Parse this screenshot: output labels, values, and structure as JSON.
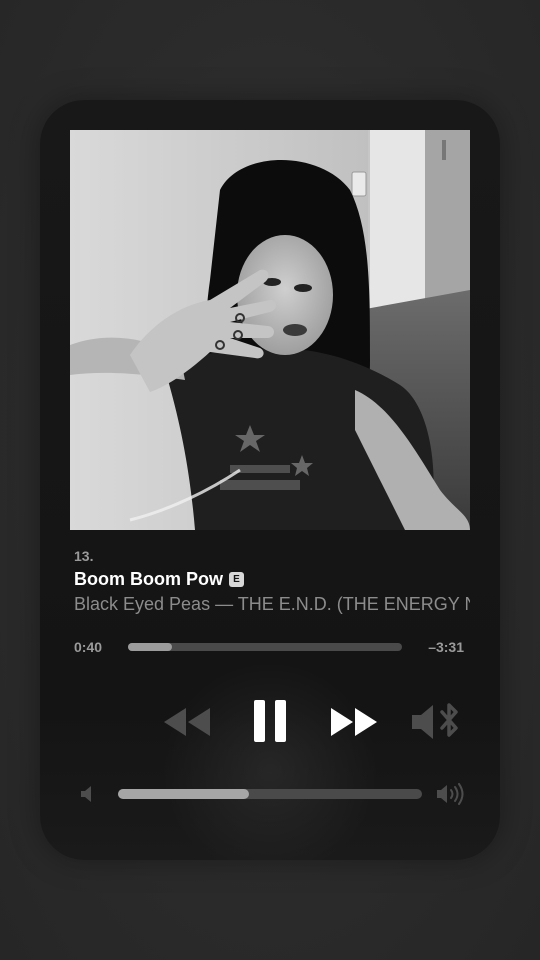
{
  "track": {
    "number": "13.",
    "title": "Boom Boom Pow",
    "explicit_badge": "E",
    "artist_album": "Black Eyed Peas — THE E.N.D. (THE ENERGY NEVER DIES)"
  },
  "progress": {
    "elapsed": "0:40",
    "remaining": "–3:31",
    "fraction": 0.16
  },
  "controls": {
    "rewind_icon": "rewind-icon",
    "pause_icon": "pause-icon",
    "fast_forward_icon": "fast-forward-icon",
    "output_icon": "speaker-bluetooth-icon"
  },
  "volume": {
    "level": 0.43,
    "low_icon": "volume-low-icon",
    "high_icon": "volume-high-icon"
  },
  "artwork": {
    "description_icon": "album-artwork"
  }
}
